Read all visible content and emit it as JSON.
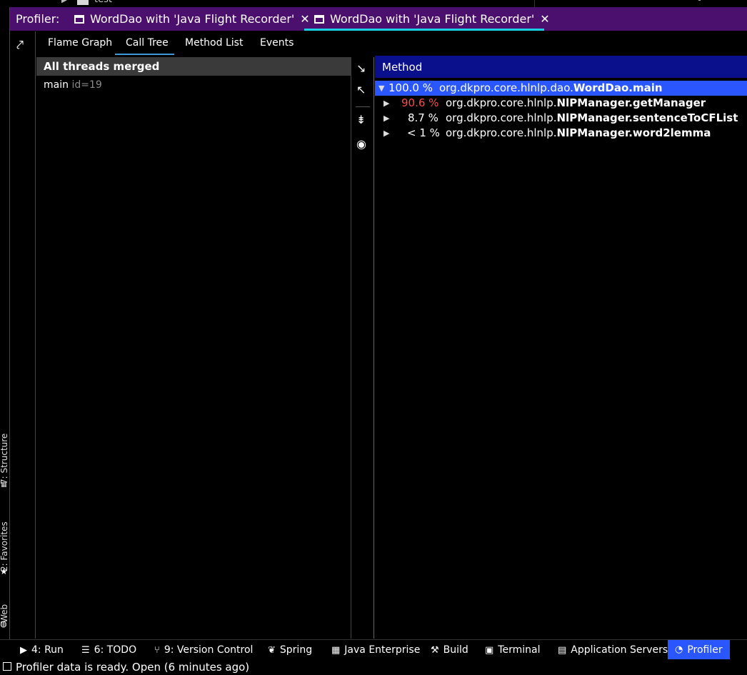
{
  "top_strip": {
    "filename": "test"
  },
  "profiler_tabs": {
    "prefix": "Profiler:",
    "tabs": [
      {
        "label": "WordDao with 'Java Flight Recorder'",
        "active": false
      },
      {
        "label": "WordDao with 'Java Flight Recorder'",
        "active": true
      }
    ]
  },
  "view_tabs": [
    "Flame Graph",
    "Call Tree",
    "Method List",
    "Events"
  ],
  "active_view": "Call Tree",
  "threads": {
    "header": "All threads merged",
    "items": [
      {
        "name": "main",
        "id": "id=19"
      }
    ]
  },
  "method_panel": {
    "header": "Method",
    "rows": [
      {
        "expanded": true,
        "percent": "100.0 %",
        "package": "org.dkpro.core.hlnlp.dao.",
        "method": "WordDao.main",
        "highlight": false
      },
      {
        "expanded": false,
        "percent": "90.6 %",
        "package": "org.dkpro.core.hlnlp.",
        "method": "NlPManager.getManager",
        "highlight": true
      },
      {
        "expanded": false,
        "percent": "8.7 %",
        "package": "org.dkpro.core.hlnlp.",
        "method": "NlPManager.sentenceToCFList",
        "highlight": false
      },
      {
        "expanded": false,
        "percent": "< 1 %",
        "package": "org.dkpro.core.hlnlp.",
        "method": "NlPManager.word2lemma",
        "highlight": false
      }
    ]
  },
  "left_tools": [
    {
      "label": "7: Structure",
      "icon": "structure-icon"
    },
    {
      "label": "2: Favorites",
      "icon": "star-icon"
    },
    {
      "label": "Web",
      "icon": "globe-icon"
    }
  ],
  "bottom_tools": [
    {
      "label": "4: Run",
      "icon": "play-icon"
    },
    {
      "label": "6: TODO",
      "icon": "list-icon"
    },
    {
      "label": "9: Version Control",
      "icon": "branch-icon"
    },
    {
      "label": "Spring",
      "icon": "leaf-icon"
    },
    {
      "label": "Java Enterprise",
      "icon": "building-icon"
    },
    {
      "label": "Build",
      "icon": "hammer-icon"
    },
    {
      "label": "Terminal",
      "icon": "terminal-icon"
    },
    {
      "label": "Application Servers",
      "icon": "server-icon"
    },
    {
      "label": "Profiler",
      "icon": "profiler-icon",
      "active": true
    }
  ],
  "status": {
    "text": "Profiler data is ready. Open (6 minutes ago)"
  },
  "colors": {
    "tabbar": "#4b0f6e",
    "method_header": "#0a0f8c",
    "selected_row": "#2a56ff",
    "active_tab_underline": "#19d2e6",
    "hot_percent": "#ff4a4a"
  }
}
